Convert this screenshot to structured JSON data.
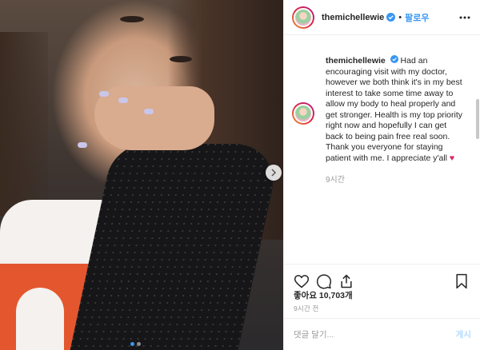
{
  "post": {
    "username": "themichellewie",
    "follow_label": "팔로우",
    "caption_username": "themichellewie",
    "caption_text": "Had an encouraging visit with my doctor, however we both think it's in my best interest to take some time away to allow my body to heal properly and get stronger. Health is my top priority right now and hopefully I can get back to being pain free real soon. Thank you everyone for staying patient with me. I appreciate y'all",
    "caption_emoji": "♥",
    "caption_time": "9시간",
    "likes_label": "좋아요 10,703개",
    "timestamp": "9시간 전"
  },
  "comment": {
    "placeholder": "댓글 달기...",
    "post_label": "게시"
  },
  "carousel": {
    "slide_count": 2,
    "active_index": 0
  },
  "colors": {
    "accent": "#3897f0",
    "heart": "#e0245e",
    "muted": "#999999"
  },
  "icons": [
    "verified-badge-icon",
    "more-options-icon",
    "like-icon",
    "comment-icon",
    "share-icon",
    "save-icon",
    "chevron-right-icon"
  ]
}
